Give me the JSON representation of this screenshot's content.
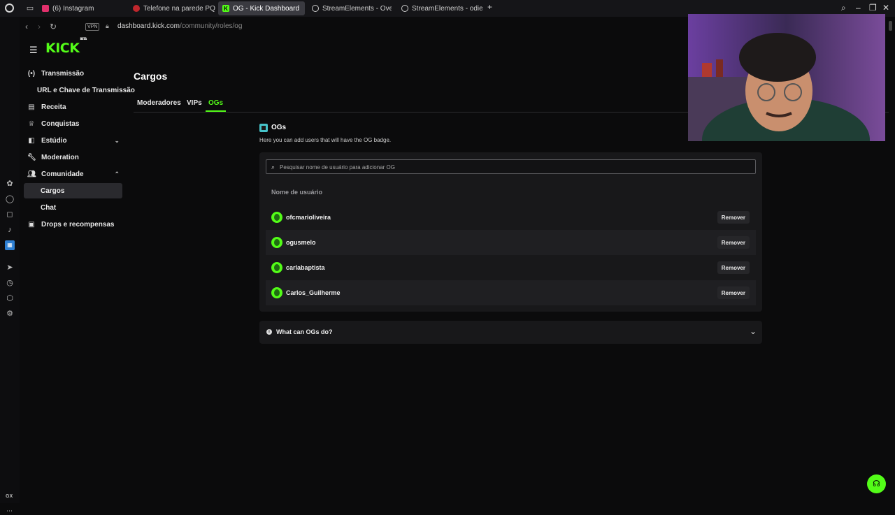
{
  "browser": {
    "tabs": [
      {
        "title": "(6) Instagram",
        "active": false,
        "fav_color": "#e1306c",
        "fav_icon": "instagram-icon"
      },
      {
        "title": "Telefone na parede PQP!",
        "active": false,
        "fav_color": "#c0272d",
        "fav_icon": "youtube-icon"
      },
      {
        "title": "OG - Kick Dashboard",
        "active": true,
        "fav_color": "#53fc18",
        "fav_icon": "kick-icon"
      },
      {
        "title": "StreamElements - Overlay",
        "active": false,
        "fav_color": "#cccccc",
        "fav_icon": "streamelements-icon"
      },
      {
        "title": "StreamElements - odiego",
        "active": false,
        "fav_color": "#cccccc",
        "fav_icon": "streamelements-icon"
      }
    ],
    "new_tab": "+",
    "vpn_label": "VPN",
    "url_host": "dashboard.kick.com",
    "url_path": "/community/roles/og",
    "gx_label": "GX"
  },
  "brand": {
    "logo": "KICK",
    "logo_badge": "BETA",
    "accent": "#53fc18"
  },
  "sidebar": {
    "items": [
      {
        "label": "Transmissão",
        "icon": "broadcast-icon"
      },
      {
        "label": "URL e Chave de Transmissão",
        "icon": ""
      },
      {
        "label": "Receita",
        "icon": "revenue-icon"
      },
      {
        "label": "Conquistas",
        "icon": "trophy-icon"
      },
      {
        "label": "Estúdio",
        "icon": "studio-icon"
      },
      {
        "label": "Moderation",
        "icon": "wrench-icon"
      },
      {
        "label": "Comunidade",
        "icon": "community-icon"
      },
      {
        "label": "Cargos",
        "icon": ""
      },
      {
        "label": "Chat",
        "icon": ""
      },
      {
        "label": "Drops e recompensas",
        "icon": "gift-icon"
      }
    ]
  },
  "page": {
    "title": "Cargos",
    "tabs": [
      {
        "label": "Moderadores",
        "active": false
      },
      {
        "label": "VIPs",
        "active": false
      },
      {
        "label": "OGs",
        "active": true
      }
    ],
    "section_title": "OGs",
    "section_desc": "Here you can add users that will have the OG badge.",
    "search_placeholder": "Pesquisar nome de usuário para adicionar OG",
    "column_header": "Nome de usuário",
    "users": [
      {
        "name": "ofcmarioliveira",
        "action": "Remover"
      },
      {
        "name": "ogusmelo",
        "action": "Remover"
      },
      {
        "name": "carlabaptista",
        "action": "Remover"
      },
      {
        "name": "Carlos_Guilherme",
        "action": "Remover"
      }
    ],
    "faq": "What can OGs do?"
  }
}
